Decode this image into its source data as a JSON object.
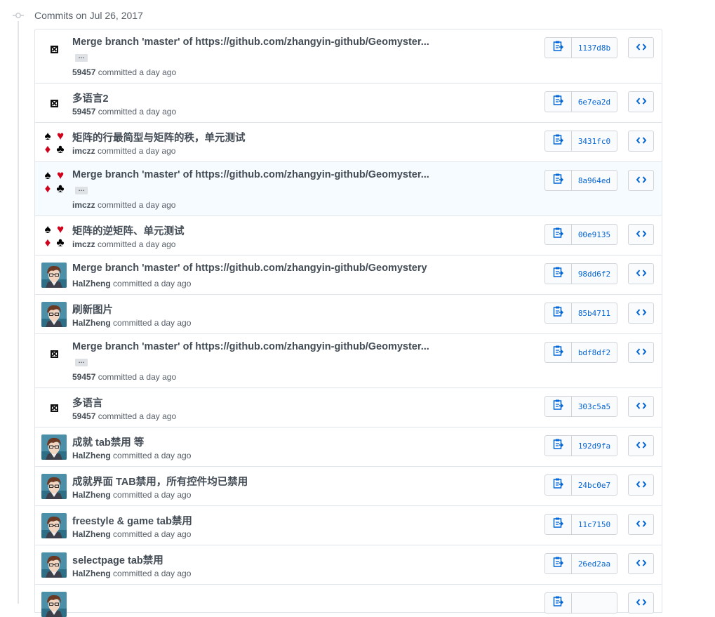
{
  "date_heading": "Commits on Jul 26, 2017",
  "ellipsis": "…",
  "icons": {
    "timeline": "git-commit-icon",
    "clipboard": "clipboard-icon",
    "browse": "code-icon",
    "default_avatar": "broken-image-icon"
  },
  "colors": {
    "link": "#0366d6",
    "border": "#e1e4e8",
    "highlight_row": "#f6fbff"
  },
  "commits": [
    {
      "title": "Merge branch 'master' of https://github.com/zhangyin-github/Geomyster...",
      "author": "59457",
      "action": "committed a day ago",
      "sha": "1137d8b",
      "avatar": "default",
      "expand": true
    },
    {
      "title": "多语言2",
      "author": "59457",
      "action": "committed a day ago",
      "sha": "6e7ea2d",
      "avatar": "default",
      "expand": false
    },
    {
      "title": "矩阵的行最简型与矩阵的秩，单元测试",
      "author": "imczz",
      "action": "committed a day ago",
      "sha": "3431fc0",
      "avatar": "cards",
      "expand": false
    },
    {
      "title": "Merge branch 'master' of https://github.com/zhangyin-github/Geomyster...",
      "author": "imczz",
      "action": "committed a day ago",
      "sha": "8a964ed",
      "avatar": "cards",
      "expand": true,
      "highlight": true
    },
    {
      "title": "矩阵的逆矩阵、单元测试",
      "author": "imczz",
      "action": "committed a day ago",
      "sha": "00e9135",
      "avatar": "cards",
      "expand": false
    },
    {
      "title": "Merge branch 'master' of https://github.com/zhangyin-github/Geomystery",
      "author": "HalZheng",
      "action": "committed a day ago",
      "sha": "98dd6f2",
      "avatar": "anime",
      "expand": false
    },
    {
      "title": "刷新图片",
      "author": "HalZheng",
      "action": "committed a day ago",
      "sha": "85b4711",
      "avatar": "anime",
      "expand": false
    },
    {
      "title": "Merge branch 'master' of https://github.com/zhangyin-github/Geomyster...",
      "author": "59457",
      "action": "committed a day ago",
      "sha": "bdf8df2",
      "avatar": "default",
      "expand": true
    },
    {
      "title": "多语言",
      "author": "59457",
      "action": "committed a day ago",
      "sha": "303c5a5",
      "avatar": "default",
      "expand": false
    },
    {
      "title": "成就 tab禁用 等",
      "author": "HalZheng",
      "action": "committed a day ago",
      "sha": "192d9fa",
      "avatar": "anime",
      "expand": false
    },
    {
      "title": "成就界面 TAB禁用，所有控件均已禁用",
      "author": "HalZheng",
      "action": "committed a day ago",
      "sha": "24bc0e7",
      "avatar": "anime",
      "expand": false
    },
    {
      "title": "freestyle & game tab禁用",
      "author": "HalZheng",
      "action": "committed a day ago",
      "sha": "11c7150",
      "avatar": "anime",
      "expand": false
    },
    {
      "title": "selectpage tab禁用",
      "author": "HalZheng",
      "action": "committed a day ago",
      "sha": "26ed2aa",
      "avatar": "anime",
      "expand": false
    },
    {
      "title": "",
      "author": "",
      "action": "",
      "sha": "",
      "avatar": "anime",
      "expand": false
    }
  ]
}
